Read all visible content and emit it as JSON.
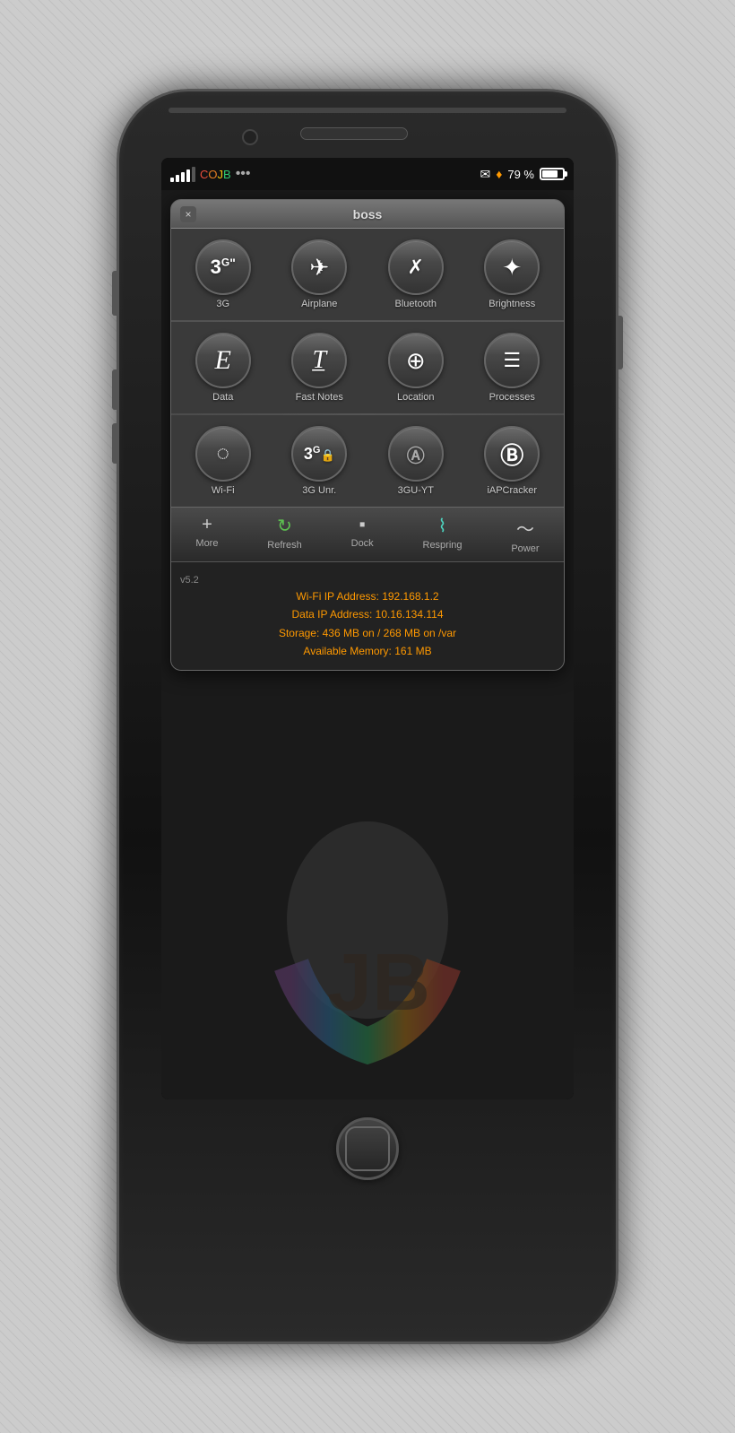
{
  "phone": {
    "status_bar": {
      "signal_strength": 4,
      "carrier": "COJB",
      "dots": "•••",
      "battery_percent": "79 %",
      "envelope": "✉",
      "location": "♦"
    },
    "sbs_panel": {
      "title": "boss",
      "close_label": "×",
      "grid_rows": [
        [
          {
            "id": "3g",
            "label": "3G",
            "icon": "3G"
          },
          {
            "id": "airplane",
            "label": "Airplane",
            "icon": "✈"
          },
          {
            "id": "bluetooth",
            "label": "Bluetooth",
            "icon": "⚡"
          },
          {
            "id": "brightness",
            "label": "Brightness",
            "icon": "☀"
          }
        ],
        [
          {
            "id": "data",
            "label": "Data",
            "icon": "E"
          },
          {
            "id": "fastnotes",
            "label": "Fast Notes",
            "icon": "✏"
          },
          {
            "id": "location",
            "label": "Location",
            "icon": "⊕"
          },
          {
            "id": "processes",
            "label": "Processes",
            "icon": "☰"
          }
        ],
        [
          {
            "id": "wifi",
            "label": "Wi-Fi",
            "icon": "⊚"
          },
          {
            "id": "3gunr",
            "label": "3G Unr.",
            "icon": "3U"
          },
          {
            "id": "3guyt",
            "label": "3GU-YT",
            "icon": "3Y"
          },
          {
            "id": "iapcracker",
            "label": "iAPCracker",
            "icon": "b"
          }
        ]
      ],
      "toolbar": [
        {
          "id": "more",
          "label": "More",
          "icon": "+",
          "color": "white"
        },
        {
          "id": "refresh",
          "label": "Refresh",
          "icon": "↻",
          "color": "green"
        },
        {
          "id": "dock",
          "label": "Dock",
          "icon": "▪",
          "color": "white"
        },
        {
          "id": "respring",
          "label": "Respring",
          "icon": "∿",
          "color": "teal"
        },
        {
          "id": "power",
          "label": "Power",
          "icon": "~",
          "color": "white"
        }
      ],
      "info": {
        "version": "v5.2",
        "lines": [
          "Wi-Fi IP Address: 192.168.1.2",
          "Data IP Address: 10.16.134.114",
          "Storage: 436 MB on / 268 MB on /var",
          "Available Memory: 161 MB"
        ]
      }
    }
  }
}
